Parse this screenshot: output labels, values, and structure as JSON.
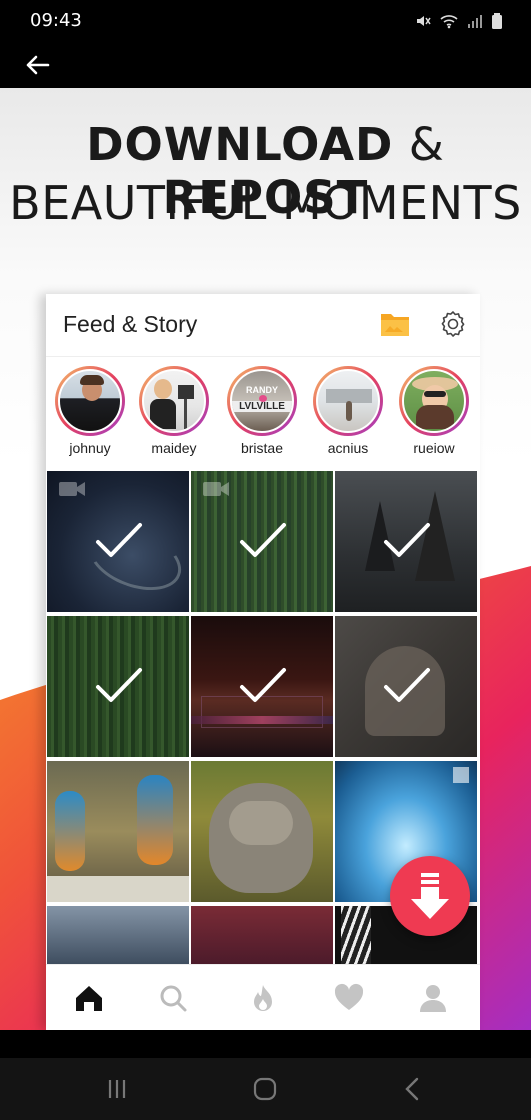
{
  "status_bar": {
    "time": "09:43"
  },
  "promo": {
    "headline_bold_1": "DOWNLOAD",
    "headline_amp": "&",
    "headline_bold_2": "REPOST",
    "headline_line2": "BEAUTIFUL MOMENTS"
  },
  "card": {
    "title": "Feed & Story",
    "stories": [
      {
        "name": "johnuy"
      },
      {
        "name": "maidey"
      },
      {
        "name": "bristae"
      },
      {
        "name": "acnius"
      },
      {
        "name": "rueiow"
      }
    ],
    "bristae_sign_top": "RANDY",
    "bristae_sign_bottom": "LVLVILLE"
  },
  "colors": {
    "accent": "#ef3a52",
    "wave_orange": "#f46b2a",
    "wave_pink": "#e8245d",
    "wave_purple": "#a52ec2"
  },
  "icons": [
    "back-arrow-icon",
    "folder-icon",
    "gear-icon",
    "check-icon",
    "video-camera-icon",
    "download-icon",
    "home-icon",
    "search-icon",
    "flame-icon",
    "heart-icon",
    "profile-icon",
    "recents-icon",
    "home-button-icon",
    "back-icon"
  ]
}
